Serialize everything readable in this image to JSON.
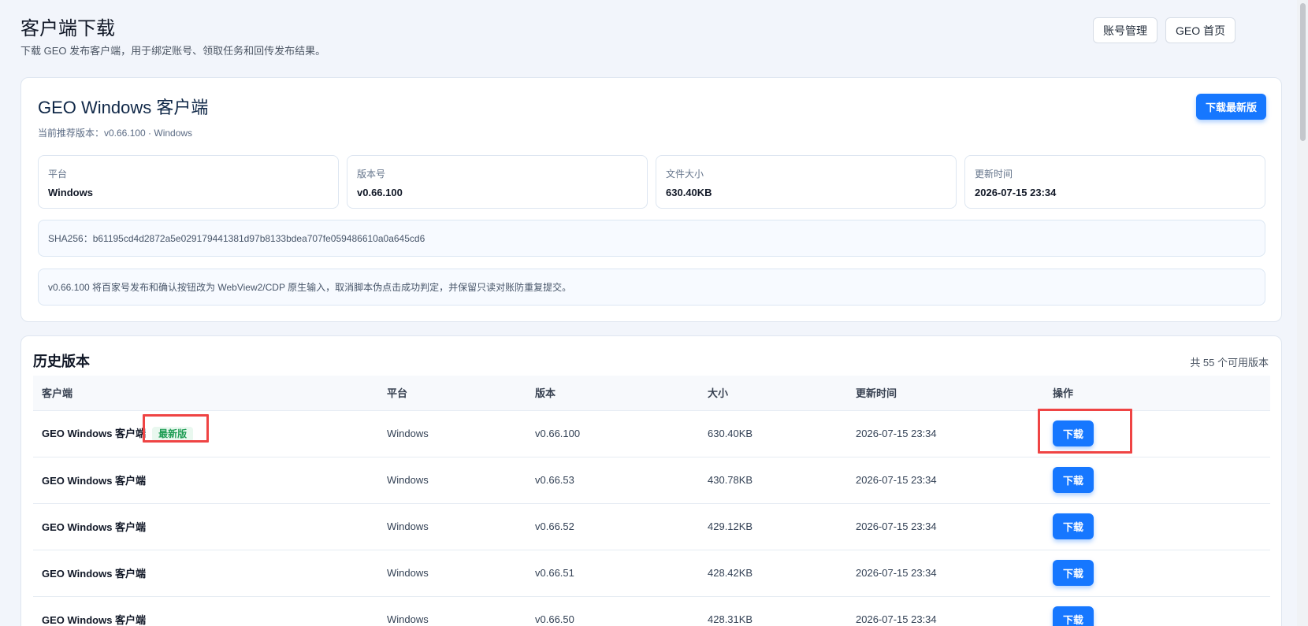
{
  "header": {
    "title": "客户端下载",
    "subtitle": "下载 GEO 发布客户端，用于绑定账号、领取任务和回传发布结果。",
    "account_button": "账号管理",
    "home_button": "GEO 首页"
  },
  "client_card": {
    "title": "GEO Windows 客户端",
    "recommended": "当前推荐版本：v0.66.100 · Windows",
    "download_latest": "下载最新版",
    "info": [
      {
        "label": "平台",
        "value": "Windows"
      },
      {
        "label": "版本号",
        "value": "v0.66.100"
      },
      {
        "label": "文件大小",
        "value": "630.40KB"
      },
      {
        "label": "更新时间",
        "value": "2026-07-15 23:34"
      }
    ],
    "sha256": "SHA256：b61195cd4d2872a5e029179441381d97b8133bdea707fe059486610a0a645cd6",
    "release_note": "v0.66.100 将百家号发布和确认按钮改为 WebView2/CDP 原生输入，取消脚本伪点击成功判定，并保留只读对账防重复提交。"
  },
  "history": {
    "title": "历史版本",
    "count": "共 55 个可用版本",
    "columns": [
      "客户端",
      "平台",
      "版本",
      "大小",
      "更新时间",
      "操作"
    ],
    "rows": [
      {
        "client": "GEO Windows 客户端",
        "badge": "最新版",
        "platform": "Windows",
        "version": "v0.66.100",
        "size": "630.40KB",
        "time": "2026-07-15 23:34",
        "action": "下载"
      },
      {
        "client": "GEO Windows 客户端",
        "badge": "",
        "platform": "Windows",
        "version": "v0.66.53",
        "size": "430.78KB",
        "time": "2026-07-15 23:34",
        "action": "下载"
      },
      {
        "client": "GEO Windows 客户端",
        "badge": "",
        "platform": "Windows",
        "version": "v0.66.52",
        "size": "429.12KB",
        "time": "2026-07-15 23:34",
        "action": "下载"
      },
      {
        "client": "GEO Windows 客户端",
        "badge": "",
        "platform": "Windows",
        "version": "v0.66.51",
        "size": "428.42KB",
        "time": "2026-07-15 23:34",
        "action": "下载"
      },
      {
        "client": "GEO Windows 客户端",
        "badge": "",
        "platform": "Windows",
        "version": "v0.66.50",
        "size": "428.31KB",
        "time": "2026-07-15 23:34",
        "action": "下载"
      }
    ]
  },
  "colors": {
    "primary": "#1677ff",
    "badge_bg": "#e9f8ef",
    "badge_text": "#1f9d55",
    "highlight": "#ef4444"
  }
}
